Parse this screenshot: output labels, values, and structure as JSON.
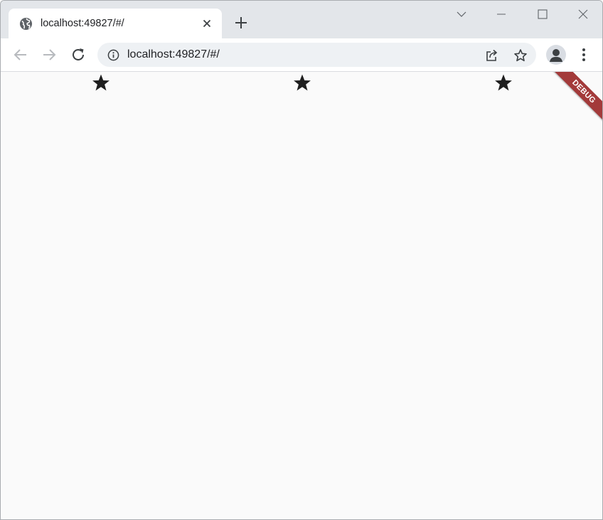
{
  "browser": {
    "tab": {
      "title": "localhost:49827/#/",
      "favicon": "globe-icon"
    },
    "address_bar": {
      "url": "localhost:49827/#/"
    },
    "toolbar_icons": [
      "back-arrow-icon",
      "forward-arrow-icon",
      "reload-icon",
      "info-icon",
      "share-icon",
      "bookmark-star-icon",
      "profile-icon",
      "menu-icon"
    ],
    "window_controls": [
      "tab-search-icon",
      "minimize-icon",
      "maximize-icon",
      "close-icon"
    ]
  },
  "page": {
    "stars": [
      {
        "icon": "star-icon"
      },
      {
        "icon": "star-icon"
      },
      {
        "icon": "star-icon"
      }
    ],
    "debug_banner": "DEBUG",
    "colors": {
      "star": "#1f1f1f",
      "banner": "#a33a3a",
      "background": "#fafafa"
    }
  }
}
